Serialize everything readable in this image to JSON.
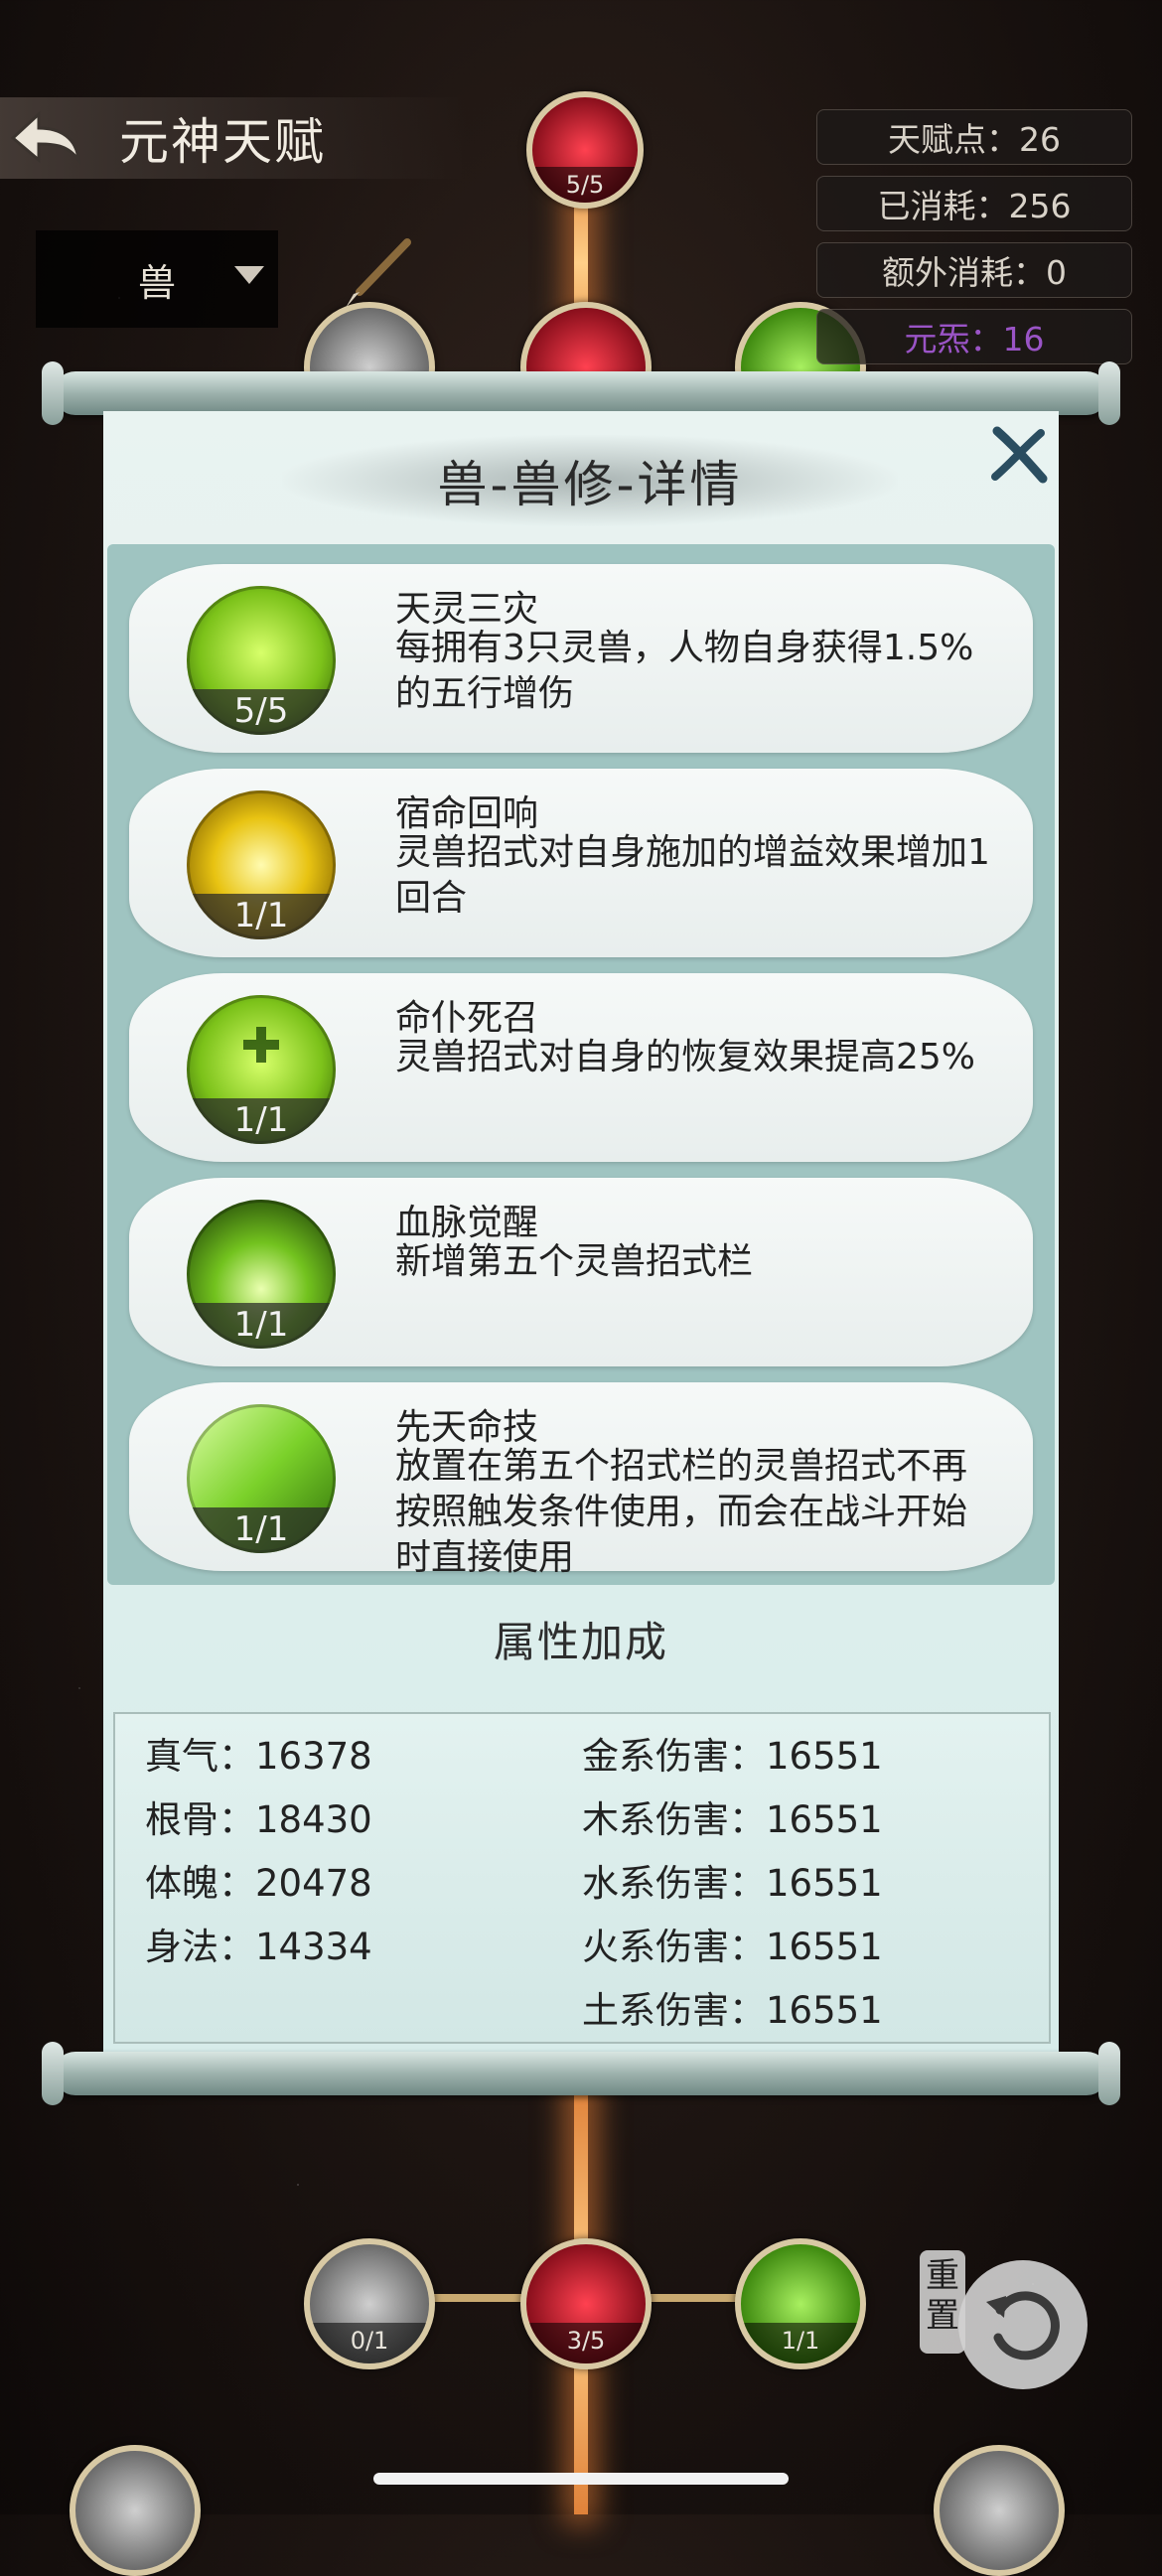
{
  "header": {
    "title": "元神天赋"
  },
  "stats": {
    "talent_points": "天赋点：26",
    "consumed": "已消耗：256",
    "extra_consumed": "额外消耗：0",
    "yuansha": "元炁：16"
  },
  "dropdown": {
    "selected": "兽"
  },
  "background_nodes": {
    "top_center": "5/5",
    "bottom_left": "0/1",
    "bottom_center": "3/5",
    "bottom_right": "1/1"
  },
  "panel": {
    "title": "兽-兽修-详情",
    "talents": [
      {
        "name": "天灵三灾",
        "desc": "每拥有3只灵兽，人物自身获得1.5%的五行增伤",
        "count": "5/5",
        "icon": "green-beast-icon"
      },
      {
        "name": "宿命回响",
        "desc": "灵兽招式对自身施加的增益效果增加1回合",
        "count": "1/1",
        "icon": "golden-rune-icon"
      },
      {
        "name": "命仆死召",
        "desc": "灵兽招式对自身的恢复效果提高25%",
        "count": "1/1",
        "icon": "green-heal-icon"
      },
      {
        "name": "血脉觉醒",
        "desc": "新增第五个灵兽招式栏",
        "count": "1/1",
        "icon": "green-flame-icon"
      },
      {
        "name": "先天命技",
        "desc": "放置在第五个招式栏的灵兽招式不再按照触发条件使用，而会在战斗开始时直接使用",
        "count": "1/1",
        "icon": "green-leaf-icon"
      }
    ],
    "attr_title": "属性加成",
    "attrs_left": [
      "真气：16378",
      "根骨：18430",
      "体魄：20478",
      "身法：14334"
    ],
    "attrs_right": [
      "金系伤害：16551",
      "木系伤害：16551",
      "水系伤害：16551",
      "火系伤害：16551",
      "土系伤害：16551"
    ]
  },
  "reset": {
    "label": "重置"
  }
}
